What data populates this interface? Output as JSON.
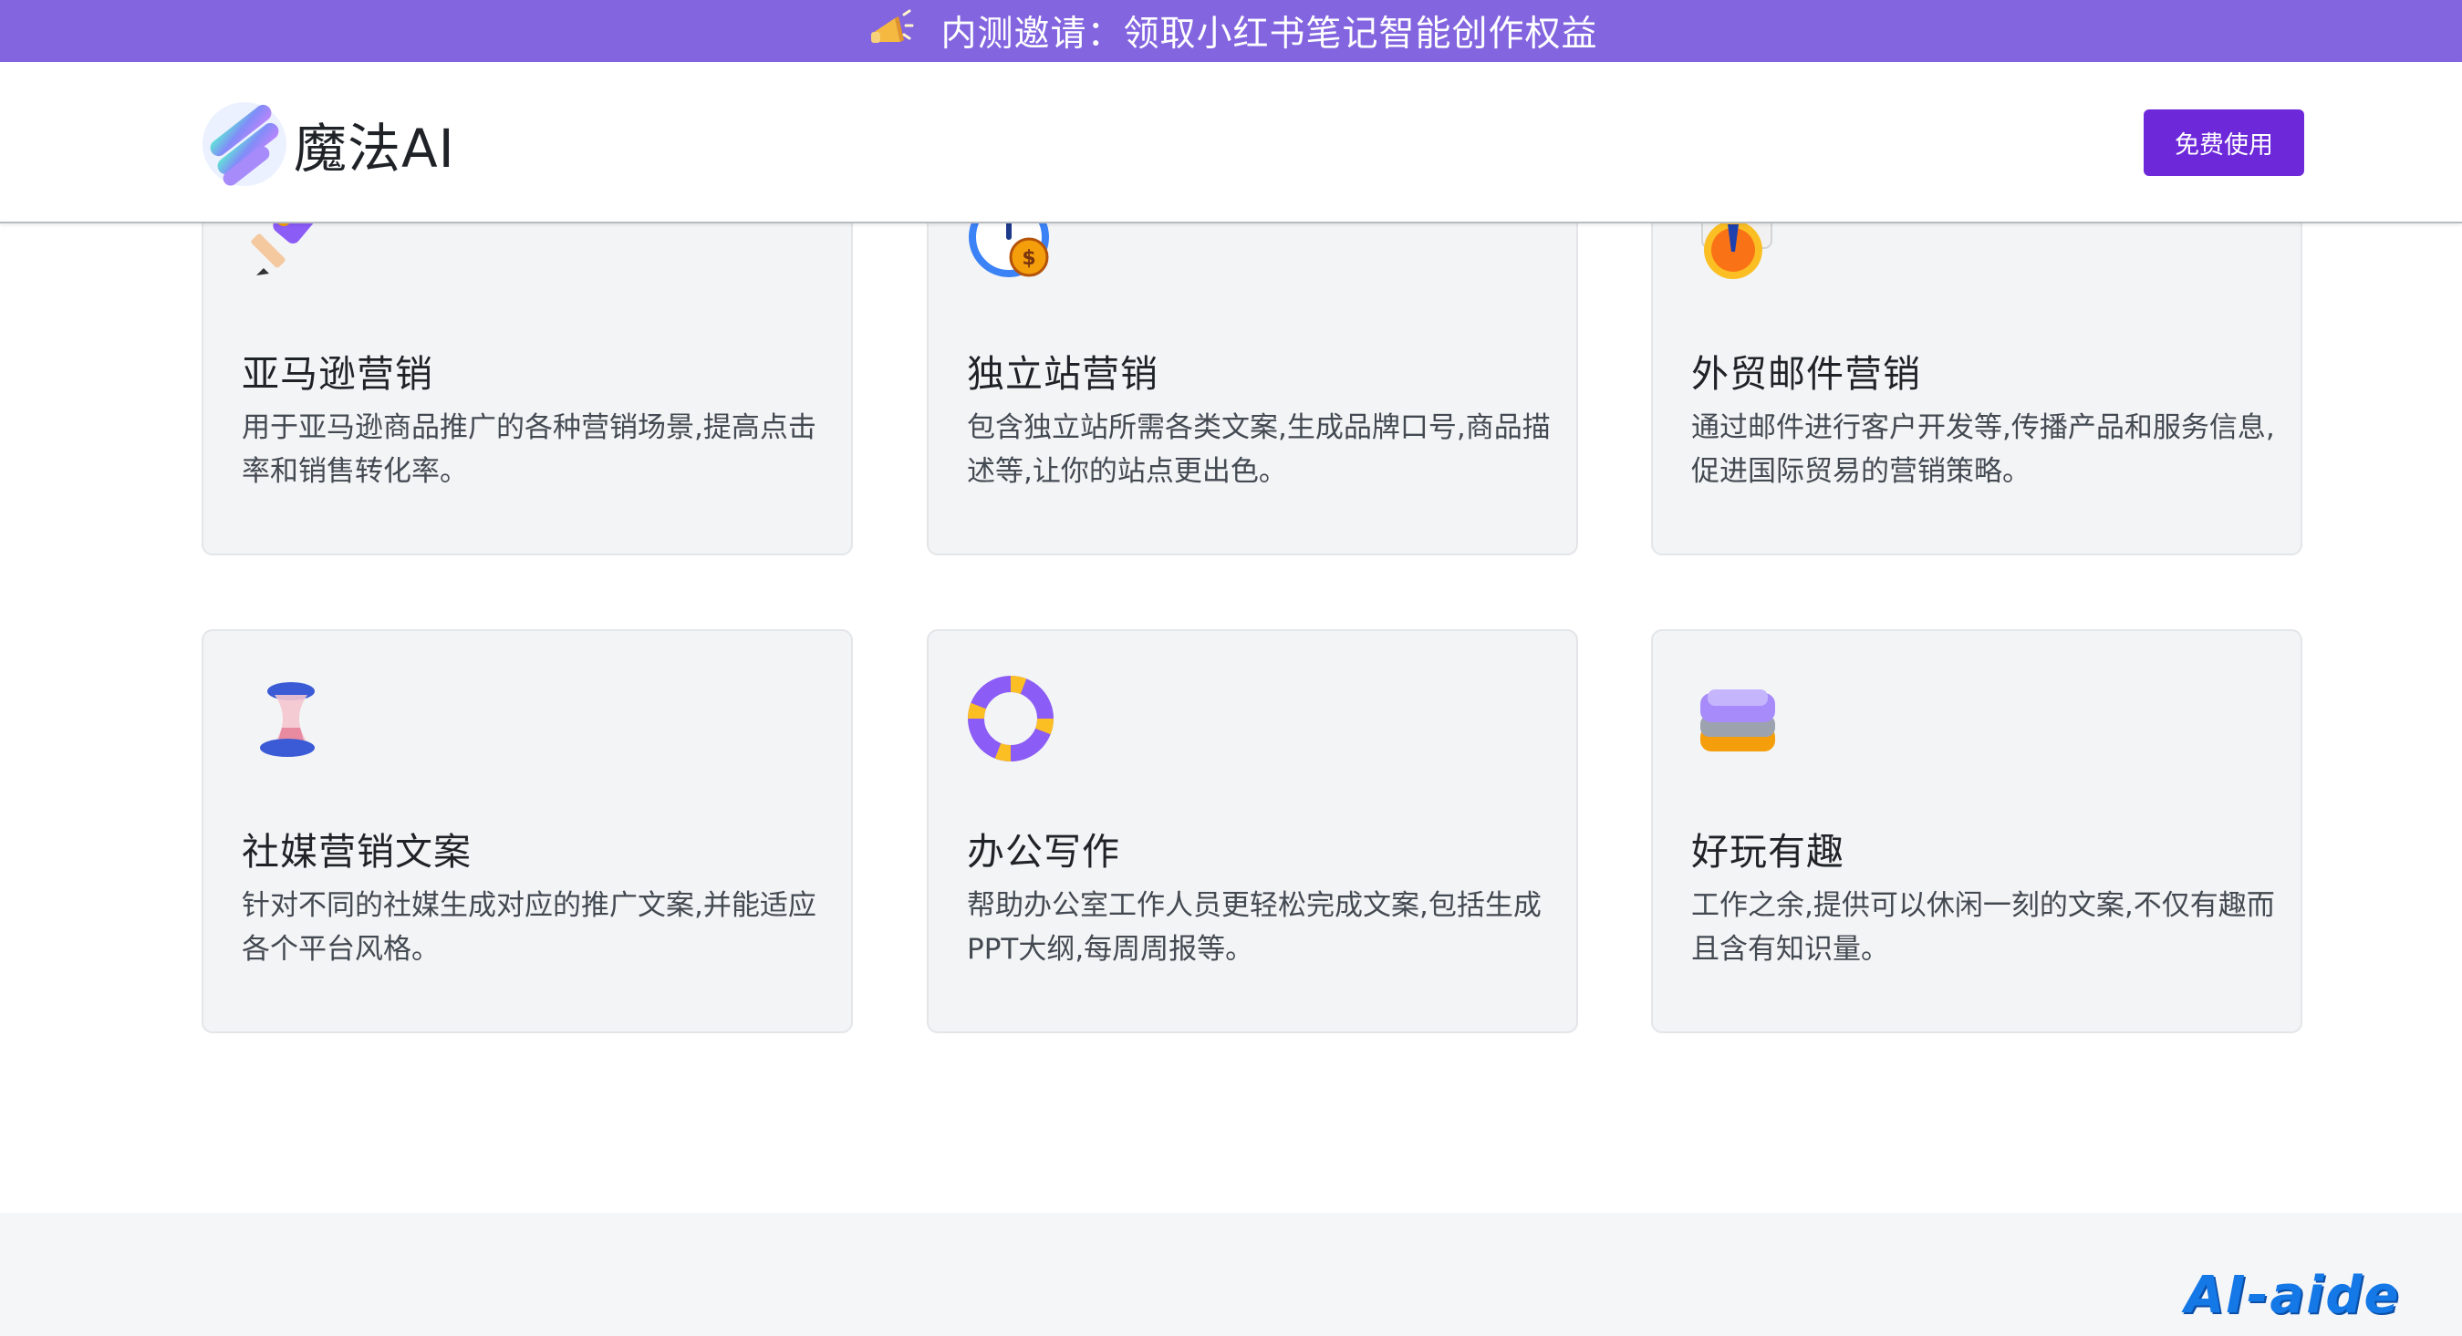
{
  "banner": {
    "icon": "megaphone-icon",
    "text": "内测邀请：领取小红书笔记智能创作权益",
    "color": "#8365e0"
  },
  "header": {
    "logo_icon": "magic-ai-logo-icon",
    "logo_text": "魔法AI",
    "cta_label": "免费使用",
    "cta_color": "#6d28d9"
  },
  "cards": [
    {
      "icon": "rocket-pencil-icon",
      "title": "亚马逊营销",
      "desc": "用于亚马逊商品推广的各种营销场景,提高点击率和销售转化率。"
    },
    {
      "icon": "money-gauge-icon",
      "title": "独立站营销",
      "desc": "包含独立站所需各类文案,生成品牌口号,商品描述等,让你的站点更出色。"
    },
    {
      "icon": "mail-badge-icon",
      "title": "外贸邮件营销",
      "desc": "通过邮件进行客户开发等,传播产品和服务信息,促进国际贸易的营销策略。"
    },
    {
      "icon": "hourglass-icon",
      "title": "社媒营销文案",
      "desc": "针对不同的社媒生成对应的推广文案,并能适应各个平台风格。"
    },
    {
      "icon": "lifebuoy-icon",
      "title": "办公写作",
      "desc": "帮助办公室工作人员更轻松完成文案,包括生成PPT大纲,每周周报等。"
    },
    {
      "icon": "stacked-layers-icon",
      "title": "好玩有趣",
      "desc": "工作之余,提供可以休闲一刻的文案,不仅有趣而且含有知识量。"
    }
  ],
  "watermark": "AI-aide"
}
